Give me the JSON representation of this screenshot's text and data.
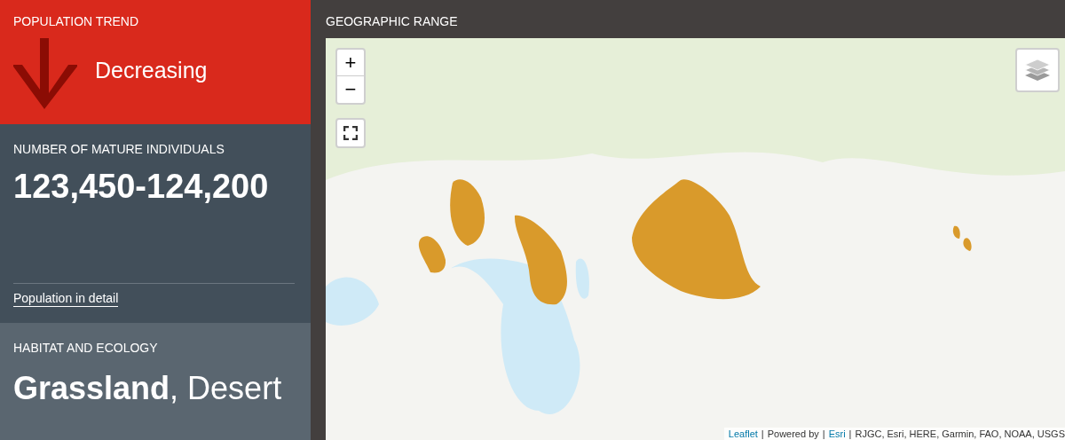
{
  "population_trend": {
    "title": "POPULATION TREND",
    "trend": "Decreasing",
    "kind": "down"
  },
  "mature_individuals": {
    "title": "NUMBER OF MATURE INDIVIDUALS",
    "value": "123,450-124,200",
    "link": "Population in detail"
  },
  "habitat": {
    "title": "HABITAT AND ECOLOGY",
    "value": "**Grassland**, Desert"
  },
  "geographic_range": {
    "title": "GEOGRAPHIC RANGE",
    "zoom_in": "+",
    "zoom_out": "−",
    "attribution_separator": "|",
    "attribution": [
      {
        "text": "Leaflet",
        "kind": "link"
      },
      {
        "text": "Powered by",
        "kind": "text"
      },
      {
        "text": "Esri",
        "kind": "link"
      },
      {
        "text": "RJGC, Esri, HERE, Garmin, FAO, NOAA, USGS",
        "kind": "text"
      }
    ]
  }
}
